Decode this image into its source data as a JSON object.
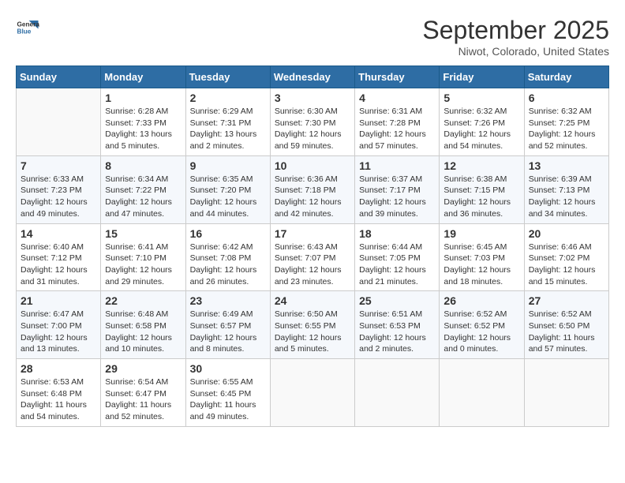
{
  "logo": {
    "line1": "General",
    "line2": "Blue"
  },
  "title": "September 2025",
  "subtitle": "Niwot, Colorado, United States",
  "weekdays": [
    "Sunday",
    "Monday",
    "Tuesday",
    "Wednesday",
    "Thursday",
    "Friday",
    "Saturday"
  ],
  "weeks": [
    [
      {
        "day": null,
        "info": null
      },
      {
        "day": "1",
        "sunrise": "Sunrise: 6:28 AM",
        "sunset": "Sunset: 7:33 PM",
        "daylight": "Daylight: 13 hours and 5 minutes."
      },
      {
        "day": "2",
        "sunrise": "Sunrise: 6:29 AM",
        "sunset": "Sunset: 7:31 PM",
        "daylight": "Daylight: 13 hours and 2 minutes."
      },
      {
        "day": "3",
        "sunrise": "Sunrise: 6:30 AM",
        "sunset": "Sunset: 7:30 PM",
        "daylight": "Daylight: 12 hours and 59 minutes."
      },
      {
        "day": "4",
        "sunrise": "Sunrise: 6:31 AM",
        "sunset": "Sunset: 7:28 PM",
        "daylight": "Daylight: 12 hours and 57 minutes."
      },
      {
        "day": "5",
        "sunrise": "Sunrise: 6:32 AM",
        "sunset": "Sunset: 7:26 PM",
        "daylight": "Daylight: 12 hours and 54 minutes."
      },
      {
        "day": "6",
        "sunrise": "Sunrise: 6:32 AM",
        "sunset": "Sunset: 7:25 PM",
        "daylight": "Daylight: 12 hours and 52 minutes."
      }
    ],
    [
      {
        "day": "7",
        "sunrise": "Sunrise: 6:33 AM",
        "sunset": "Sunset: 7:23 PM",
        "daylight": "Daylight: 12 hours and 49 minutes."
      },
      {
        "day": "8",
        "sunrise": "Sunrise: 6:34 AM",
        "sunset": "Sunset: 7:22 PM",
        "daylight": "Daylight: 12 hours and 47 minutes."
      },
      {
        "day": "9",
        "sunrise": "Sunrise: 6:35 AM",
        "sunset": "Sunset: 7:20 PM",
        "daylight": "Daylight: 12 hours and 44 minutes."
      },
      {
        "day": "10",
        "sunrise": "Sunrise: 6:36 AM",
        "sunset": "Sunset: 7:18 PM",
        "daylight": "Daylight: 12 hours and 42 minutes."
      },
      {
        "day": "11",
        "sunrise": "Sunrise: 6:37 AM",
        "sunset": "Sunset: 7:17 PM",
        "daylight": "Daylight: 12 hours and 39 minutes."
      },
      {
        "day": "12",
        "sunrise": "Sunrise: 6:38 AM",
        "sunset": "Sunset: 7:15 PM",
        "daylight": "Daylight: 12 hours and 36 minutes."
      },
      {
        "day": "13",
        "sunrise": "Sunrise: 6:39 AM",
        "sunset": "Sunset: 7:13 PM",
        "daylight": "Daylight: 12 hours and 34 minutes."
      }
    ],
    [
      {
        "day": "14",
        "sunrise": "Sunrise: 6:40 AM",
        "sunset": "Sunset: 7:12 PM",
        "daylight": "Daylight: 12 hours and 31 minutes."
      },
      {
        "day": "15",
        "sunrise": "Sunrise: 6:41 AM",
        "sunset": "Sunset: 7:10 PM",
        "daylight": "Daylight: 12 hours and 29 minutes."
      },
      {
        "day": "16",
        "sunrise": "Sunrise: 6:42 AM",
        "sunset": "Sunset: 7:08 PM",
        "daylight": "Daylight: 12 hours and 26 minutes."
      },
      {
        "day": "17",
        "sunrise": "Sunrise: 6:43 AM",
        "sunset": "Sunset: 7:07 PM",
        "daylight": "Daylight: 12 hours and 23 minutes."
      },
      {
        "day": "18",
        "sunrise": "Sunrise: 6:44 AM",
        "sunset": "Sunset: 7:05 PM",
        "daylight": "Daylight: 12 hours and 21 minutes."
      },
      {
        "day": "19",
        "sunrise": "Sunrise: 6:45 AM",
        "sunset": "Sunset: 7:03 PM",
        "daylight": "Daylight: 12 hours and 18 minutes."
      },
      {
        "day": "20",
        "sunrise": "Sunrise: 6:46 AM",
        "sunset": "Sunset: 7:02 PM",
        "daylight": "Daylight: 12 hours and 15 minutes."
      }
    ],
    [
      {
        "day": "21",
        "sunrise": "Sunrise: 6:47 AM",
        "sunset": "Sunset: 7:00 PM",
        "daylight": "Daylight: 12 hours and 13 minutes."
      },
      {
        "day": "22",
        "sunrise": "Sunrise: 6:48 AM",
        "sunset": "Sunset: 6:58 PM",
        "daylight": "Daylight: 12 hours and 10 minutes."
      },
      {
        "day": "23",
        "sunrise": "Sunrise: 6:49 AM",
        "sunset": "Sunset: 6:57 PM",
        "daylight": "Daylight: 12 hours and 8 minutes."
      },
      {
        "day": "24",
        "sunrise": "Sunrise: 6:50 AM",
        "sunset": "Sunset: 6:55 PM",
        "daylight": "Daylight: 12 hours and 5 minutes."
      },
      {
        "day": "25",
        "sunrise": "Sunrise: 6:51 AM",
        "sunset": "Sunset: 6:53 PM",
        "daylight": "Daylight: 12 hours and 2 minutes."
      },
      {
        "day": "26",
        "sunrise": "Sunrise: 6:52 AM",
        "sunset": "Sunset: 6:52 PM",
        "daylight": "Daylight: 12 hours and 0 minutes."
      },
      {
        "day": "27",
        "sunrise": "Sunrise: 6:52 AM",
        "sunset": "Sunset: 6:50 PM",
        "daylight": "Daylight: 11 hours and 57 minutes."
      }
    ],
    [
      {
        "day": "28",
        "sunrise": "Sunrise: 6:53 AM",
        "sunset": "Sunset: 6:48 PM",
        "daylight": "Daylight: 11 hours and 54 minutes."
      },
      {
        "day": "29",
        "sunrise": "Sunrise: 6:54 AM",
        "sunset": "Sunset: 6:47 PM",
        "daylight": "Daylight: 11 hours and 52 minutes."
      },
      {
        "day": "30",
        "sunrise": "Sunrise: 6:55 AM",
        "sunset": "Sunset: 6:45 PM",
        "daylight": "Daylight: 11 hours and 49 minutes."
      },
      {
        "day": null,
        "info": null
      },
      {
        "day": null,
        "info": null
      },
      {
        "day": null,
        "info": null
      },
      {
        "day": null,
        "info": null
      }
    ]
  ]
}
